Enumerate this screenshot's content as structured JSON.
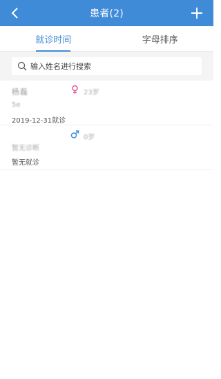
{
  "header": {
    "title": "患者(2)"
  },
  "tabs": [
    {
      "label": "就诊时间",
      "active": true
    },
    {
      "label": "字母排序",
      "active": false
    }
  ],
  "search": {
    "placeholder": "输入姓名进行搜索"
  },
  "patients": [
    {
      "name": "杨磊",
      "gender": "female",
      "age": "23岁",
      "diagnosis": "5e",
      "last_visit": "2019-12-31就诊"
    },
    {
      "name": "",
      "gender": "male",
      "age": "0岁",
      "diagnosis": "暂无诊断",
      "last_visit": "暂无就诊"
    }
  ],
  "colors": {
    "accent": "#3f8bd8",
    "female": "#e0559a",
    "male": "#3f8bd8"
  }
}
